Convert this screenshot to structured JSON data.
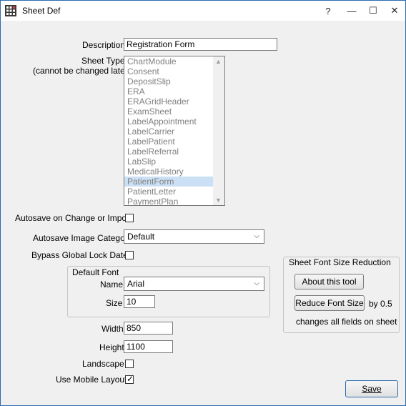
{
  "window": {
    "title": "Sheet Def",
    "help_label": "?",
    "minimize_label": "—",
    "maximize_label": "☐",
    "close_label": "✕"
  },
  "form": {
    "description_label": "Description",
    "description_value": "Registration Form",
    "sheet_type_label": "Sheet Type",
    "sheet_type_note": "(cannot be changed later)",
    "sheet_types": [
      "ChartModule",
      "Consent",
      "DepositSlip",
      "ERA",
      "ERAGridHeader",
      "ExamSheet",
      "LabelAppointment",
      "LabelCarrier",
      "LabelPatient",
      "LabelReferral",
      "LabSlip",
      "MedicalHistory",
      "PatientForm",
      "PatientLetter",
      "PaymentPlan"
    ],
    "sheet_type_selected": "PatientForm",
    "autosave_label": "Autosave on Change or Import",
    "autosave_checked": false,
    "autosave_image_category_label": "Autosave Image Category",
    "autosave_image_category_value": "Default",
    "bypass_lock_label": "Bypass Global Lock Date",
    "bypass_lock_checked": false,
    "default_font_title": "Default Font",
    "font_name_label": "Name",
    "font_name_value": "Arial",
    "font_size_label": "Size",
    "font_size_value": "10",
    "width_label": "Width",
    "width_value": "850",
    "height_label": "Height",
    "height_value": "1100",
    "landscape_label": "Landscape",
    "landscape_checked": false,
    "mobile_label": "Use Mobile Layout",
    "mobile_checked": true
  },
  "font_reduction": {
    "title": "Sheet Font Size Reduction",
    "about_button": "About this tool",
    "reduce_button": "Reduce Font Size",
    "by_label": "by 0.5",
    "note": "changes all fields on sheet"
  },
  "footer": {
    "save_label": "Save"
  },
  "colors": {
    "accent": "#2b6cb0",
    "selection": "#cce0f5",
    "disabled_text": "#808080"
  }
}
